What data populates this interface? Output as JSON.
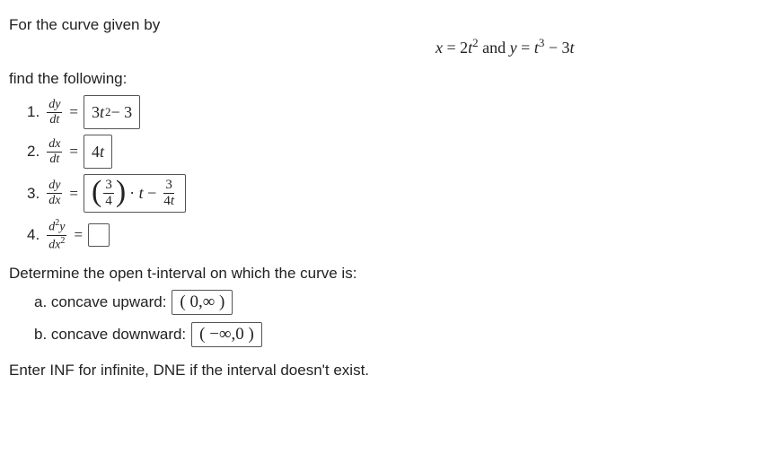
{
  "intro": "For the curve given by",
  "equations": "x = 2t² and y = t³ − 3t",
  "find": "find the following:",
  "items": {
    "i1": {
      "lhs_top": "dy",
      "lhs_bot": "dt",
      "ans": "3t² − 3"
    },
    "i2": {
      "lhs_top": "dx",
      "lhs_bot": "dt",
      "ans": "4t"
    },
    "i3": {
      "lhs_top": "dy",
      "lhs_bot": "dx",
      "frac_top": "3",
      "frac_bot": "4",
      "mid": "· t −",
      "frac2_top": "3",
      "frac2_bot": "4t"
    },
    "i4": {
      "lhs_top": "d²y",
      "lhs_bot": "dx²"
    }
  },
  "determine": "Determine the open t-interval on which the curve is:",
  "a_label": "a. concave upward:",
  "a_ans": "( 0,∞ )",
  "b_label": "b. concave downward:",
  "b_ans": "( −∞,0 )",
  "footer": "Enter INF for infinite, DNE if the interval doesn't exist.",
  "chart_data": {
    "type": "table",
    "problem": "parametric curve x=2t^2, y=t^3-3t",
    "derivatives": {
      "dy_dt": "3t^2 - 3",
      "dx_dt": "4t",
      "dy_dx": "(3/4)t - 3/(4t)",
      "d2y_dx2": ""
    },
    "concave_up_interval": "(0, INF)",
    "concave_down_interval": "(-INF, 0)"
  }
}
